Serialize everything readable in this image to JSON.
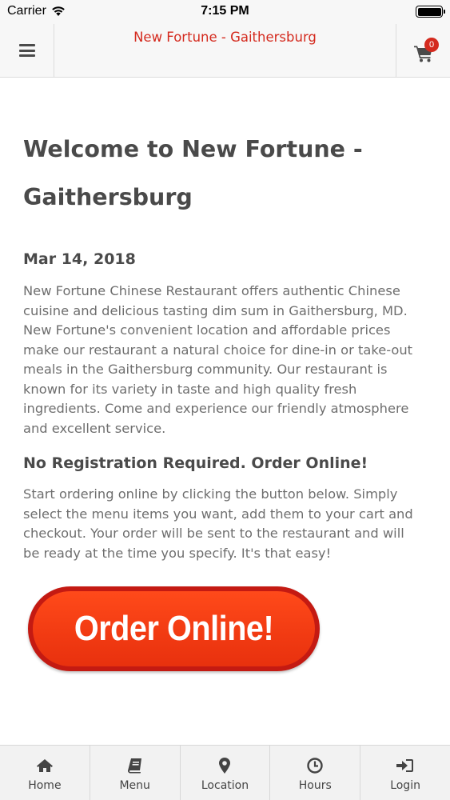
{
  "status_bar": {
    "carrier": "Carrier",
    "time": "7:15 PM"
  },
  "header": {
    "title": "New Fortune - Gaithersburg",
    "cart_count": "0",
    "accent_color": "#d42a1e"
  },
  "main": {
    "welcome_title": "Welcome to New Fortune - Gaithersburg",
    "date": "Mar 14, 2018",
    "intro": "New Fortune Chinese Restaurant offers authentic Chinese cuisine and delicious tasting dim sum in Gaithersburg, MD.  New Fortune's convenient location and affordable prices make our restaurant a natural choice for dine-in or take-out meals in the Gaithersburg community. Our restaurant is known for its variety in taste and high quality fresh ingredients. Come and experience our friendly atmosphere and excellent service.",
    "heading": "No Registration Required. Order Online!",
    "instructions": "Start ordering online by clicking the button below. Simply select the menu items you want, add them to your cart and checkout. Your order will be sent to the restaurant and will be ready at the time you specify. It's that easy!",
    "order_button_label": "Order Online!"
  },
  "bottom_nav": {
    "items": [
      {
        "label": "Home",
        "icon": "home-icon"
      },
      {
        "label": "Menu",
        "icon": "book-icon"
      },
      {
        "label": "Location",
        "icon": "map-pin-icon"
      },
      {
        "label": "Hours",
        "icon": "clock-icon"
      },
      {
        "label": "Login",
        "icon": "sign-in-icon"
      }
    ]
  }
}
